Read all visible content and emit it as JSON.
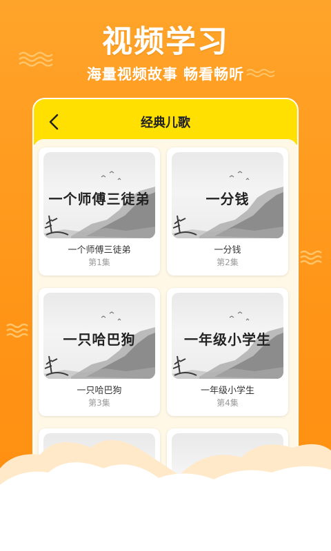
{
  "hero": {
    "title": "视频学习",
    "subtitle": "海量视频故事  畅看畅听"
  },
  "header": {
    "back_icon": "chevron-left-icon",
    "title": "经典儿歌"
  },
  "videos": [
    {
      "thumb_text": "一个师傅三徒弟",
      "title": "一个师傅三徒弟",
      "episode": "第1集"
    },
    {
      "thumb_text": "一分钱",
      "title": "一分钱",
      "episode": "第2集"
    },
    {
      "thumb_text": "一只哈巴狗",
      "title": "一只哈巴狗",
      "episode": "第3集"
    },
    {
      "thumb_text": "一年级小学生",
      "title": "一年级小学生",
      "episode": "第4集"
    },
    {
      "thumb_text": "",
      "title": "",
      "episode": ""
    },
    {
      "thumb_text": "",
      "title": "",
      "episode": ""
    }
  ],
  "colors": {
    "background": "#FF9A1E",
    "header": "#FFE000",
    "panel": "#FFF8E6",
    "cloud": "#FFE9C9"
  }
}
